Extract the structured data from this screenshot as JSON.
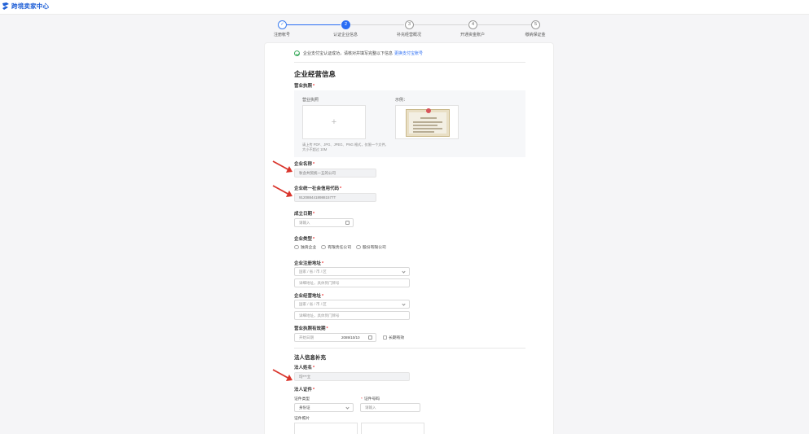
{
  "header": {
    "app_title": "跨境卖家中心",
    "logo_icon": "brand-logo-icon"
  },
  "steps": [
    {
      "num": "✓",
      "label": "注册帐号",
      "state": "done"
    },
    {
      "num": "2",
      "label": "认证企业信息",
      "state": "active"
    },
    {
      "num": "3",
      "label": "补充经营概况",
      "state": "todo"
    },
    {
      "num": "4",
      "label": "开通资金账户",
      "state": "todo"
    },
    {
      "num": "5",
      "label": "缴纳保证金",
      "state": "todo"
    }
  ],
  "notice": {
    "text": "企业支付宝认证成功，请核对并填写完整以下信息",
    "link": "更换支付宝账号"
  },
  "section1": {
    "title": "企业经营信息"
  },
  "license": {
    "label": "营业执照",
    "upload_title": "营业执照",
    "upload_plus": "+",
    "upload_hint": "请上传 PDF、JPG、JPEG、PNG 格式，仅限一个文件，大小不超过 10M",
    "example_label": "示例："
  },
  "company_name": {
    "label": "企业名称",
    "value": "秋含共贸统一五的公司"
  },
  "credit_code": {
    "label": "企业统一社会信用代码",
    "value": "91208844189881577T"
  },
  "found_date": {
    "label": "成立日期",
    "placeholder": "请输入"
  },
  "company_type": {
    "label": "企业类型",
    "options": [
      "独资企业",
      "有限责任公司",
      "股份有限公司"
    ]
  },
  "reg_address": {
    "label": "企业注册地址",
    "region_placeholder": "国家 / 省 / 市 / 区",
    "detail_placeholder": "详细地址，具体到门牌号"
  },
  "biz_address": {
    "label": "企业经营地址",
    "region_placeholder": "国家 / 省 / 市 / 区",
    "detail_placeholder": "详细地址，具体到门牌号"
  },
  "validity": {
    "label": "营业执照有效期",
    "start_placeholder": "开始日期",
    "end_value": "2089/10/10",
    "long_term": "长期有效"
  },
  "section2": {
    "title": "法人信息补充"
  },
  "legal_name": {
    "label": "法人姓名",
    "value": "均***立"
  },
  "legal_id": {
    "label": "法人证件",
    "type_label": "证件类型",
    "type_value": "身份证",
    "number_label": "证件号码",
    "number_placeholder": "请输入",
    "photo_label": "证件照片"
  },
  "colors": {
    "accent": "#2a6df4",
    "success": "#3aaa5c",
    "required": "#e33333",
    "arrow": "#d9342b"
  }
}
